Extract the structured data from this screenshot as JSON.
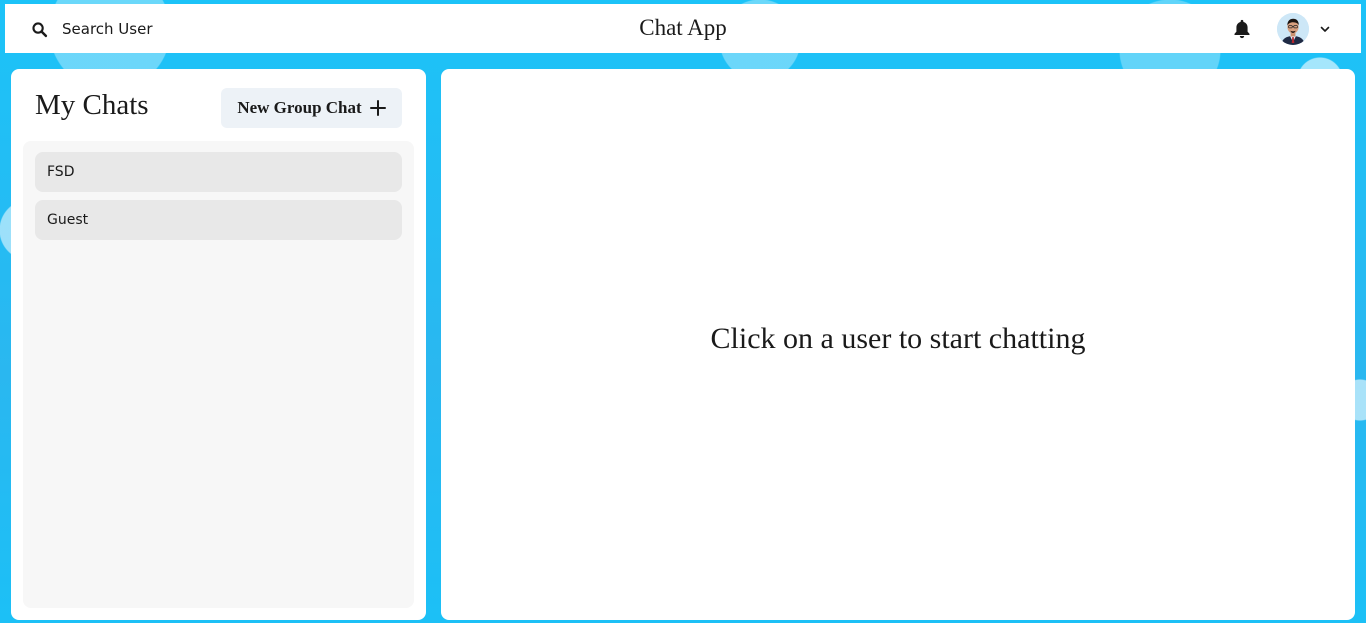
{
  "header": {
    "search_label": "Search User",
    "app_title": "Chat App",
    "notification_icon": "bell-icon",
    "avatar_icon": "user-avatar",
    "menu_icon": "chevron-down-icon"
  },
  "sidebar": {
    "title": "My Chats",
    "new_group_label": "New Group Chat",
    "new_group_icon": "plus-icon",
    "chats": [
      {
        "label": "FSD"
      },
      {
        "label": "Guest"
      }
    ]
  },
  "main": {
    "placeholder": "Click on a user to start chatting"
  },
  "colors": {
    "background": "#1cc2f7",
    "panel": "#ffffff",
    "chat_list_bg": "#f7f7f7",
    "chat_item_bg": "#e8e8e8",
    "button_bg": "#edf2f7"
  }
}
